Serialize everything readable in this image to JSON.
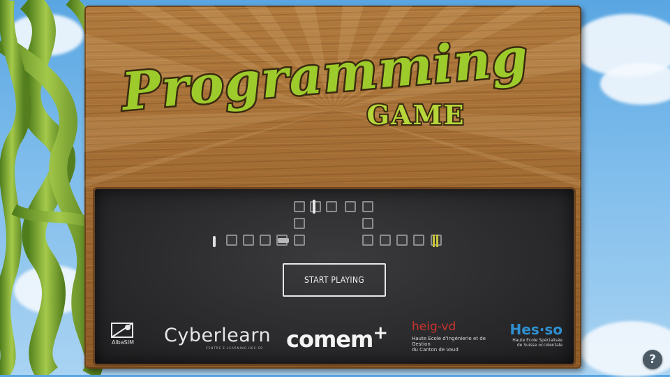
{
  "title": {
    "main": "Programming",
    "sub": "GAME"
  },
  "start_button": {
    "label": "START PLAYING"
  },
  "logos": {
    "albasim": "AlbaSIM",
    "cyberlearn": "Cyberlearn",
    "cyberlearn_tagline": "CENTRE E-LEARNING HES-SO",
    "comem": "comem",
    "comem_plus": "+",
    "heig": "heig-vd",
    "heig_line1": "Haute Ecole d'Ingénierie et de Gestion",
    "heig_line2": "du Canton de Vaud",
    "hesso": "Hes·so",
    "hesso_line1": "Haute Ecole Spécialisée",
    "hesso_line2": "de Suisse occidentale"
  },
  "help_button": {
    "icon": "question-icon",
    "label": "?"
  },
  "colors": {
    "title_green": "#9ecb2c",
    "title_outline": "#3a2a10",
    "chalk": "#8d8d8f",
    "cyberlearn_blue": "#27a8d8",
    "heig_red": "#c8322e",
    "hesso_blue": "#2f8fd0"
  }
}
